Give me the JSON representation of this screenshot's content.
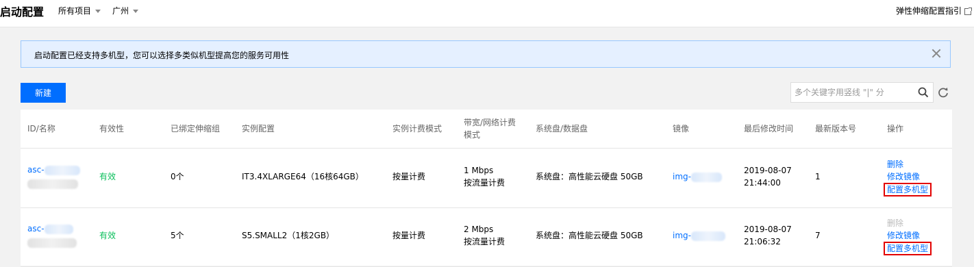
{
  "header": {
    "title": "启动配置",
    "project_dropdown": "所有项目",
    "region_dropdown": "广州",
    "guide_link": "弹性伸缩配置指引"
  },
  "notice": {
    "text": "启动配置已经支持多机型，您可以选择多类似机型提高您的服务可用性"
  },
  "toolbar": {
    "new_label": "新建",
    "search_placeholder": "多个关键字用竖线 \"|\" 分"
  },
  "table": {
    "columns": [
      "ID/名称",
      "有效性",
      "已绑定伸缩组",
      "实例配置",
      "实例计费模式",
      "带宽/网络计费模式",
      "系统盘/数据盘",
      "镜像",
      "最后修改时间",
      "最新版本号",
      "操作"
    ],
    "col_bandwidth_line1": "带宽/网络计费",
    "col_bandwidth_line2": "模式",
    "rows": [
      {
        "id": "asc-",
        "validity": "有效",
        "bound_groups": "0个",
        "instance_config": "IT3.4XLARGE64（16核64GB）",
        "billing_mode": "按量计费",
        "bandwidth": "1 Mbps",
        "network_billing": "按流量计费",
        "disk": "系统盘：高性能云硬盘 50GB",
        "image": "img-",
        "modified_date": "2019-08-07",
        "modified_time": "21:44:00",
        "version": "1",
        "op_delete": "删除",
        "op_modify_image": "修改镜像",
        "op_multi_type": "配置多机型",
        "delete_enabled": true
      },
      {
        "id": "asc-",
        "validity": "有效",
        "bound_groups": "5个",
        "instance_config": "S5.SMALL2（1核2GB）",
        "billing_mode": "按量计费",
        "bandwidth": "2 Mbps",
        "network_billing": "按流量计费",
        "disk": "系统盘：高性能云硬盘 50GB",
        "image": "img-",
        "modified_date": "2019-08-07",
        "modified_time": "21:06:32",
        "version": "7",
        "op_delete": "删除",
        "op_modify_image": "修改镜像",
        "op_multi_type": "配置多机型",
        "delete_enabled": false
      }
    ]
  },
  "colors": {
    "accent": "#006eff",
    "valid_green": "#0abf5b",
    "highlight_red": "#e20000",
    "notice_bg": "#e5f0ff"
  }
}
